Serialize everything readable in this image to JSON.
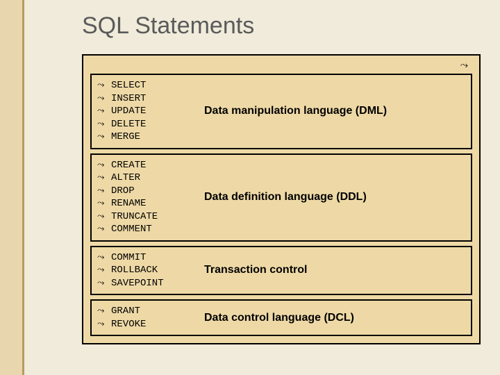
{
  "title": "SQL Statements",
  "glyph": "⤳",
  "groups": [
    {
      "commands": [
        "SELECT",
        "INSERT",
        "UPDATE",
        "DELETE",
        "MERGE"
      ],
      "label": "Data manipulation language (DML)"
    },
    {
      "commands": [
        "CREATE",
        "ALTER",
        "DROP",
        "RENAME",
        "TRUNCATE",
        "COMMENT"
      ],
      "label": "Data definition language (DDL)"
    },
    {
      "commands": [
        "COMMIT",
        "ROLLBACK",
        "SAVEPOINT"
      ],
      "label": "Transaction control"
    },
    {
      "commands": [
        "GRANT",
        "REVOKE"
      ],
      "label": "Data control language (DCL)"
    }
  ]
}
